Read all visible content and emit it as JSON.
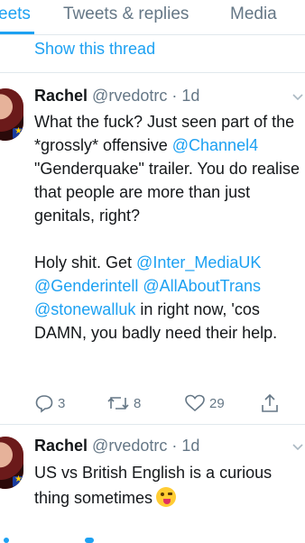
{
  "tabs": [
    {
      "label": "eets",
      "active": true
    },
    {
      "label": "Tweets & replies",
      "active": false
    },
    {
      "label": "Media",
      "active": false
    }
  ],
  "show_thread": "Show this thread",
  "tweet1": {
    "name": "Rachel",
    "handle": "@rvedotrc",
    "dot": " · ",
    "time": "1d",
    "text_a": "What the fuck? Just seen part of the *grossly* offensive ",
    "link1": "@Channel4",
    "text_b": " \"Genderquake\" trailer. You do realise that people are more than just genitals, right?",
    "text_c": "Holy shit. Get ",
    "link2": "@Inter_MediaUK",
    "link3": "@Genderintell",
    "link4": "@AllAboutTrans",
    "link5": "@stonewalluk",
    "text_d": " in right now, 'cos DAMN, you badly need their help.",
    "reply_count": "3",
    "retweet_count": "8",
    "like_count": "29"
  },
  "tweet2": {
    "name": "Rachel",
    "handle": "@rvedotrc",
    "dot": " · ",
    "time": "1d",
    "text": "US vs British English is a curious thing sometimes"
  },
  "colors": {
    "accent": "#1da1f2",
    "muted": "#657786",
    "text": "#14171a",
    "border": "#e1e8ed"
  },
  "icons": [
    "reply-icon",
    "retweet-icon",
    "like-icon",
    "share-icon",
    "chevron-down-icon",
    "winking-tongue-emoji"
  ]
}
